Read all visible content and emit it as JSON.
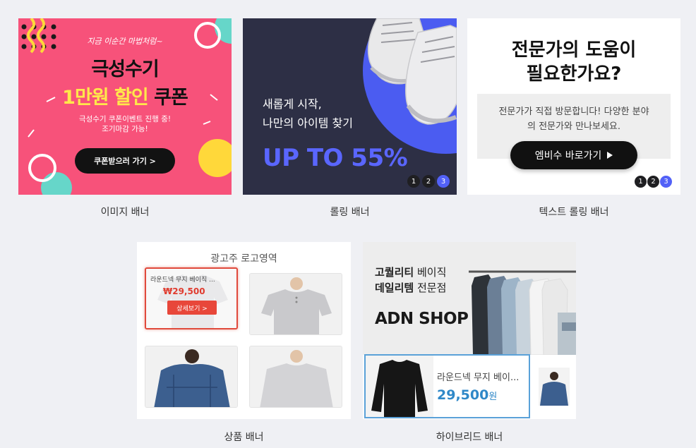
{
  "image_banner": {
    "script_text": "지금 이순간 마법처럼~",
    "headline_1": "극성수기",
    "headline_2_yellow": "1만원 할인",
    "headline_2_black": " 쿠폰",
    "sub_line_1": "극성수기 쿠폰이벤트 진행 중!",
    "sub_line_2": "조기마감 가능!",
    "button": "쿠폰받으러 가기 >",
    "caption": "이미지 배너"
  },
  "rolling_banner": {
    "line_1": "새롭게 시작,",
    "line_2": "나만의 아이템 찾기",
    "promo": "UP TO 55%",
    "pages": [
      "1",
      "2",
      "3"
    ],
    "active_page": "3",
    "caption": "롤링 배너"
  },
  "text_rolling_banner": {
    "title_1": "전문가의 도움이",
    "title_2": "필요한가요?",
    "desc_1": "전문가가 직접 방문합니다! 다양한 분야",
    "desc_2": "의 전문가와 만나보세요.",
    "button": "엠비수 바로가기",
    "button_icon": "play-icon",
    "pages": [
      "1",
      "2",
      "3"
    ],
    "active_page": "3",
    "caption": "텍스트 롤링 배너"
  },
  "product_banner": {
    "logo_area": "광고주 로고영역",
    "featured": {
      "name": "라운드넥 무지 베이직 ...",
      "price": "₩29,500",
      "detail_button": "상세보기 >"
    },
    "caption": "상품 배너"
  },
  "hybrid_banner": {
    "headline_1_bold": "고퀄리티",
    "headline_1_rest": " 베이직",
    "headline_2_bold": "데일리템",
    "headline_2_rest": " 전문점",
    "shop_name": "ADN SHOP",
    "product_name": "라운드넥 무지 베이...",
    "product_price": "29,500",
    "price_unit": "원",
    "caption": "하이브리드 배너"
  },
  "colors": {
    "page_bg": "#eff0f4",
    "pink": "#f7527a",
    "navy": "#2d2f45",
    "accent_blue": "#5261f7",
    "product_red": "#e8473a",
    "hybrid_blue": "#2f88c8"
  }
}
